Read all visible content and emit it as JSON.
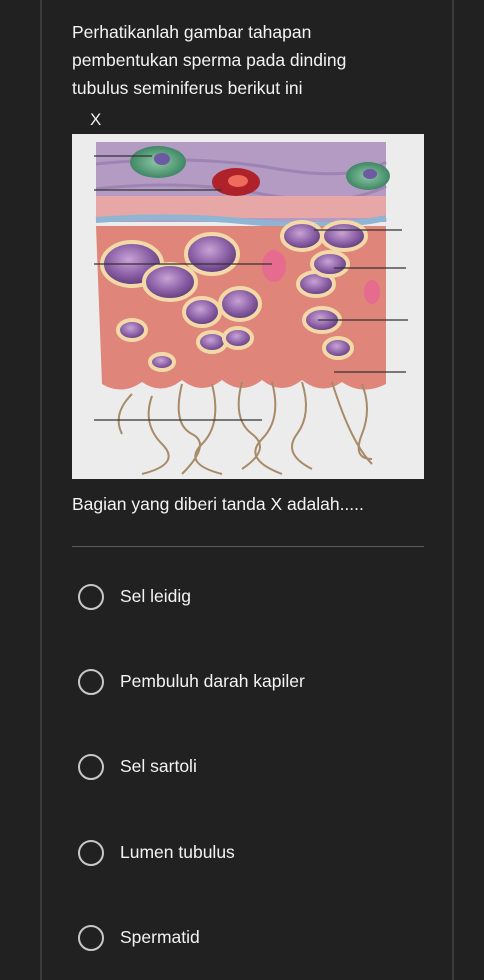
{
  "question": {
    "text": "Perhatikanlah gambar tahapan pembentukan sperma pada dinding tubulus seminiferus berikut ini",
    "marker": "X"
  },
  "figure": {
    "description_icon": "seminiferous-tubule-illustration"
  },
  "prompt": "Bagian yang diberi tanda X adalah.....",
  "options": [
    {
      "label": "Sel leidig"
    },
    {
      "label": "Pembuluh darah kapiler"
    },
    {
      "label": "Sel sartoli"
    },
    {
      "label": "Lumen tubulus"
    },
    {
      "label": "Spermatid"
    }
  ],
  "colors": {
    "background": "#212121",
    "text": "#f3f3f3",
    "radio_border": "#c8c8c8"
  }
}
